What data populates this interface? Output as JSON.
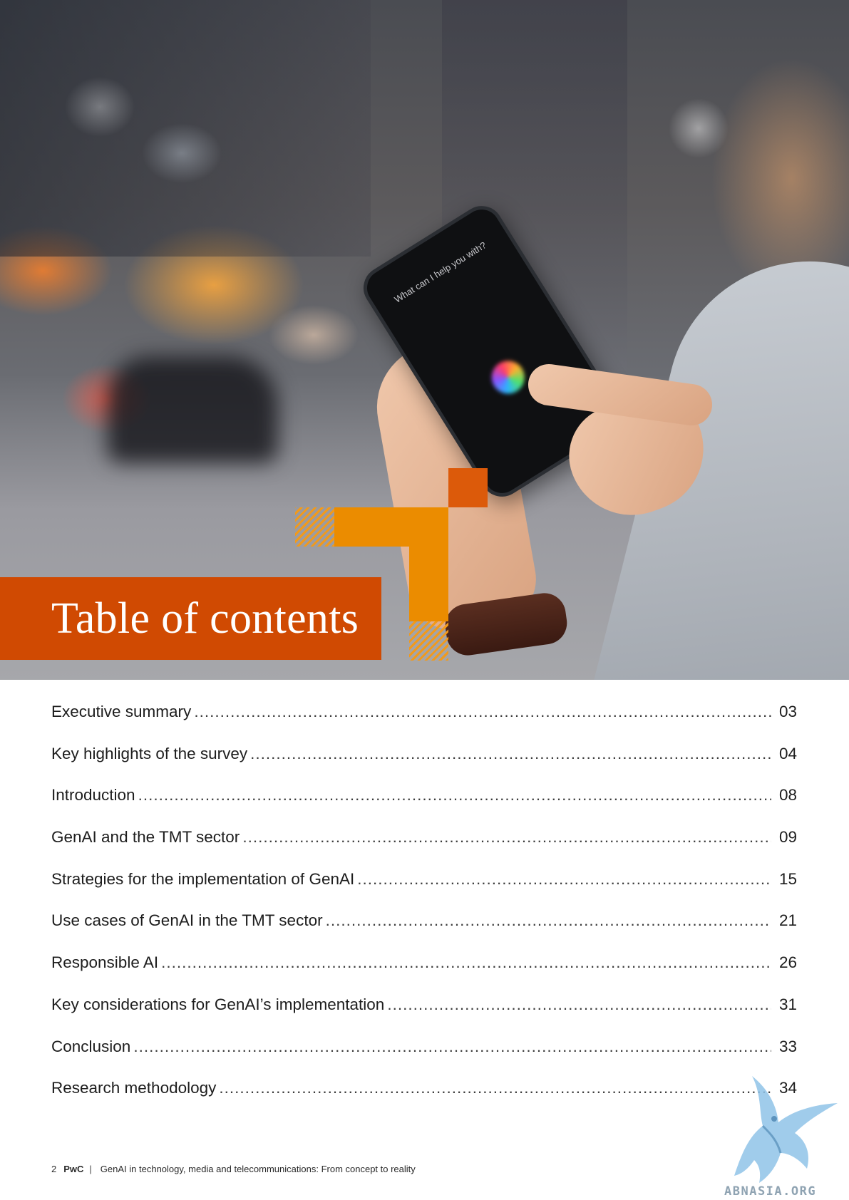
{
  "hero": {
    "phone_prompt": "What can I help you with?",
    "title": "Table of contents",
    "colors": {
      "banner": "#d04a02",
      "accent_orange": "#eb8c00",
      "accent_dark_orange": "#dc5a0a"
    }
  },
  "toc": {
    "entries": [
      {
        "label": "Executive summary",
        "page": "03"
      },
      {
        "label": "Key highlights of the survey",
        "page": "04"
      },
      {
        "label": "Introduction",
        "page": "08"
      },
      {
        "label": "GenAI and the TMT sector",
        "page": "09"
      },
      {
        "label": "Strategies for the implementation of GenAI",
        "page": "15"
      },
      {
        "label": "Use cases of GenAI in the TMT sector",
        "page": "21"
      },
      {
        "label": "Responsible AI",
        "page": "26"
      },
      {
        "label": "Key considerations for GenAI’s implementation",
        "page": "31"
      },
      {
        "label": "Conclusion",
        "page": "33"
      },
      {
        "label": "Research methodology",
        "page": "34"
      }
    ]
  },
  "footer": {
    "page_number": "2",
    "brand": "PwC",
    "separator": "|",
    "document_title": "GenAI in technology, media and telecommunications: From concept to reality"
  },
  "watermark": {
    "text": "ABNASIA.ORG",
    "icon": "griffin-icon"
  }
}
